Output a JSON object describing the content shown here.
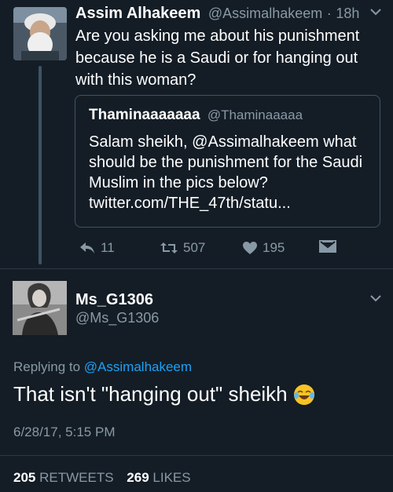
{
  "tweet": {
    "author_name": "Assim Alhakeem",
    "author_handle": "@Assimalhakeem",
    "time_sep": "·",
    "time": "18h",
    "text": "Are you asking me about his punishment because he is a Saudi or for hanging out with this woman?",
    "quoted": {
      "author_name": "Thaminaaaaaaa",
      "author_handle": "@Thaminaaaaa",
      "text": "Salam sheikh, @Assimalhakeem what should be the punishment for the Saudi Muslim in the pics below? twitter.com/THE_47th/statu..."
    },
    "actions": {
      "reply_count": "11",
      "retweet_count": "507",
      "like_count": "195"
    },
    "icons": [
      "reply-icon",
      "retweet-icon",
      "heart-icon",
      "direct-message-icon",
      "chevron-down-icon"
    ]
  },
  "reply": {
    "author_name": "Ms_G1306",
    "author_handle": "@Ms_G1306",
    "replying_prefix": "Replying to",
    "replying_to": "@Assimalhakeem",
    "text": "That isn't \"hanging out\" sheikh",
    "emoji": "face-with-tears-of-joy",
    "timestamp": "6/28/17, 5:15 PM",
    "retweets_count": "205",
    "retweets_label": "RETWEETS",
    "likes_count": "269",
    "likes_label": "LIKES"
  },
  "colors": {
    "background": "#141d26",
    "secondary_text": "#8899a6",
    "link": "#1da1f2",
    "border": "#3d5466"
  }
}
